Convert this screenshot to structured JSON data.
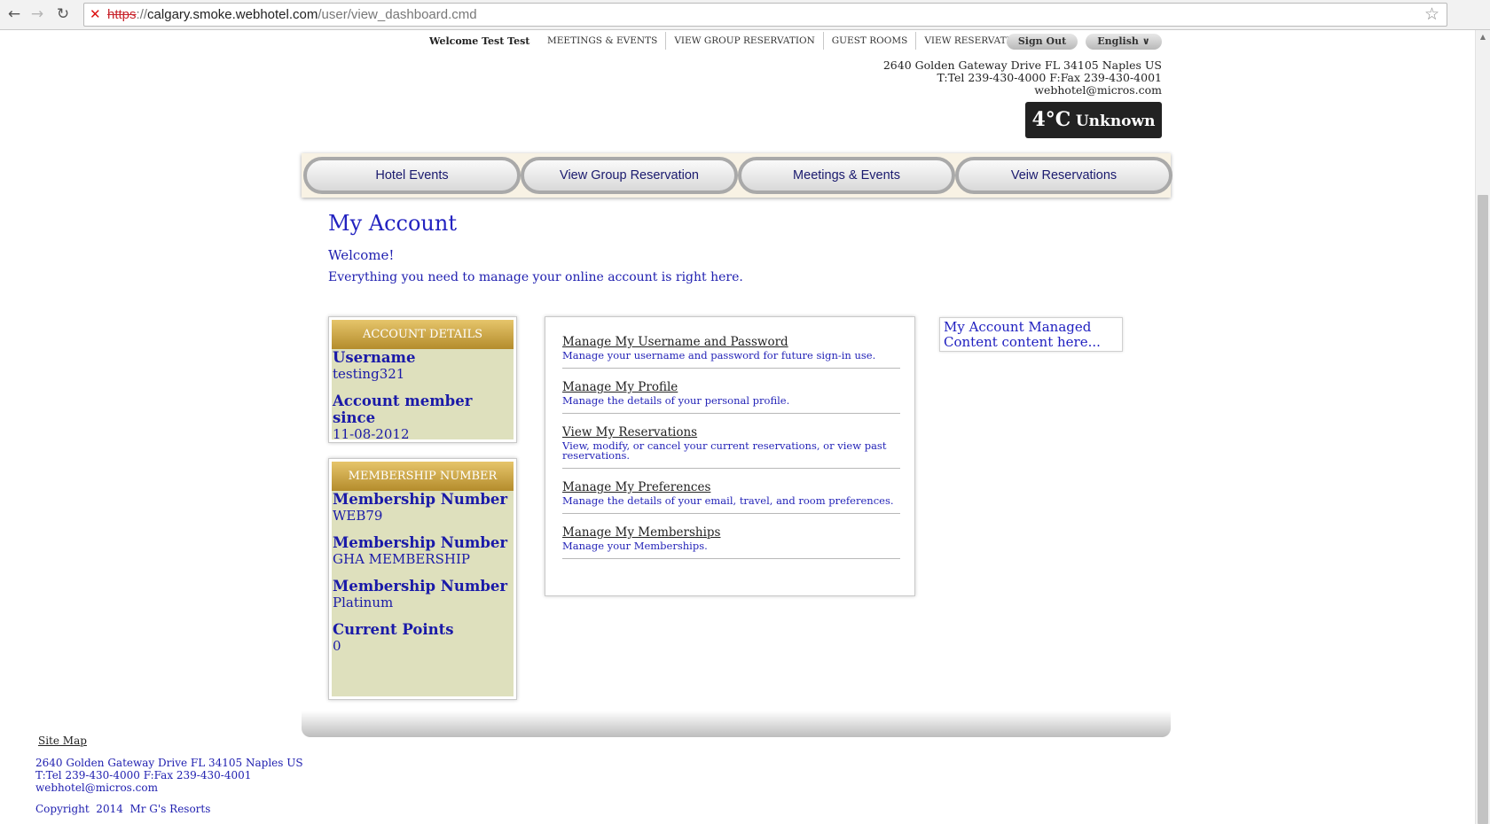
{
  "browser": {
    "url_scheme": "https",
    "url_sep": "://",
    "url_host": "calgary.smoke.webhotel.com",
    "url_path": "/user/view_dashboard.cmd"
  },
  "topbar": {
    "welcome": "Welcome Test Test",
    "links": [
      "MEETINGS & EVENTS",
      "VIEW GROUP RESERVATION",
      "GUEST ROOMS",
      "VIEW RESERVATION"
    ],
    "sign_out": "Sign Out",
    "language": "English ∨"
  },
  "header": {
    "address": "2640 Golden Gateway Drive FL 34105 Naples US",
    "phone": "T:Tel 239-430-4000 F:Fax 239-430-4001",
    "email": "webhotel@micros.com",
    "weather_temp": "4°C",
    "weather_cond": "Unknown"
  },
  "mainnav": {
    "tabs": [
      "Hotel Events",
      "View Group Reservation",
      "Meetings & Events",
      "Veiw Reservations"
    ]
  },
  "content": {
    "title": "My Account",
    "welcome": "Welcome!",
    "intro": "Everything you need to manage your online account is right here."
  },
  "account_details": {
    "heading": "ACCOUNT DETAILS",
    "username_label": "Username",
    "username": "testing321",
    "since_label": "Account member since",
    "since": "11-08-2012"
  },
  "membership": {
    "heading": "MEMBERSHIP NUMBER",
    "items": [
      {
        "label": "Membership Number",
        "value": "WEB79"
      },
      {
        "label": "Membership Number",
        "value": "GHA MEMBERSHIP"
      },
      {
        "label": "Membership Number",
        "value": "Platinum"
      },
      {
        "label": "Current Points",
        "value": "0"
      }
    ]
  },
  "manage_links": [
    {
      "title": "Manage My Username and Password",
      "desc": "Manage your username and password for future sign-in use."
    },
    {
      "title": "Manage My Profile",
      "desc": "Manage the details of your personal profile."
    },
    {
      "title": "View My Reservations",
      "desc": "View, modify, or cancel your current reservations, or view past reservations."
    },
    {
      "title": "Manage My Preferences",
      "desc": "Manage the details of your email, travel, and room preferences."
    },
    {
      "title": "Manage My Memberships",
      "desc": "Manage your Memberships."
    }
  ],
  "managed_content": "My Account Managed Content content here...",
  "footer": {
    "site_map": "Site Map",
    "address": "2640 Golden Gateway Drive FL 34105 Naples US",
    "phone": "T:Tel 239-430-4000 F:Fax 239-430-4001",
    "email": "webhotel@micros.com",
    "copyright": "Copyright  2014  Mr G's Resorts"
  }
}
